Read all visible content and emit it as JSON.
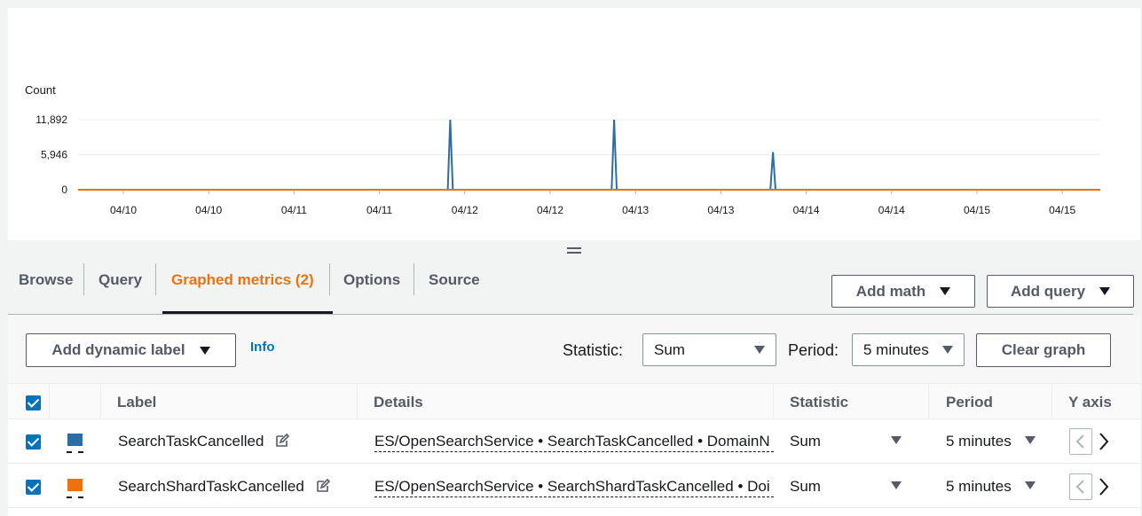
{
  "chart_data": {
    "type": "line",
    "ylabel": "Count",
    "y_ticks": [
      "11,892",
      "5,946",
      "0"
    ],
    "ylim": [
      0,
      11892
    ],
    "x_ticks": [
      "04/10",
      "04/10",
      "04/11",
      "04/11",
      "04/12",
      "04/12",
      "04/13",
      "04/13",
      "04/14",
      "04/14",
      "04/15",
      "04/15"
    ],
    "series": [
      {
        "name": "SearchTaskCancelled",
        "color": "#2e6da4",
        "points": [
          [
            0,
            0
          ],
          [
            3.8,
            0
          ],
          [
            3.83,
            11892
          ],
          [
            3.86,
            0
          ],
          [
            5.72,
            0
          ],
          [
            5.75,
            11892
          ],
          [
            5.78,
            0
          ],
          [
            7.58,
            0
          ],
          [
            7.61,
            6400
          ],
          [
            7.64,
            0
          ],
          [
            11.5,
            0
          ]
        ]
      },
      {
        "name": "SearchShardTaskCancelled",
        "color": "#ec7211",
        "points": [
          [
            0,
            0
          ],
          [
            11.5,
            0
          ]
        ]
      }
    ]
  },
  "tabs": {
    "browse": "Browse",
    "query": "Query",
    "graphed": "Graphed metrics (2)",
    "options": "Options",
    "source": "Source"
  },
  "actions": {
    "add_math": "Add math",
    "add_query": "Add query"
  },
  "toolbar": {
    "add_dynamic_label": "Add dynamic label",
    "info": "Info",
    "statistic_label": "Statistic:",
    "statistic_value": "Sum",
    "period_label": "Period:",
    "period_value": "5 minutes",
    "clear_graph": "Clear graph"
  },
  "table": {
    "headers": {
      "label": "Label",
      "details": "Details",
      "statistic": "Statistic",
      "period": "Period",
      "yaxis": "Y axis"
    },
    "rows": [
      {
        "color": "#2e6da4",
        "label": "SearchTaskCancelled",
        "details": "ES/OpenSearchService • SearchTaskCancelled • DomainN",
        "statistic": "Sum",
        "period": "5 minutes"
      },
      {
        "color": "#ec7211",
        "label": "SearchShardTaskCancelled",
        "details": "ES/OpenSearchService • SearchShardTaskCancelled • Doi",
        "statistic": "Sum",
        "period": "5 minutes"
      }
    ]
  },
  "icons": {
    "edit": "edit-icon",
    "dropdown": "caret-down-icon",
    "y_left": "chevron-left-icon",
    "y_right": "chevron-right-icon",
    "checkbox": "checkbox-checked-icon"
  }
}
